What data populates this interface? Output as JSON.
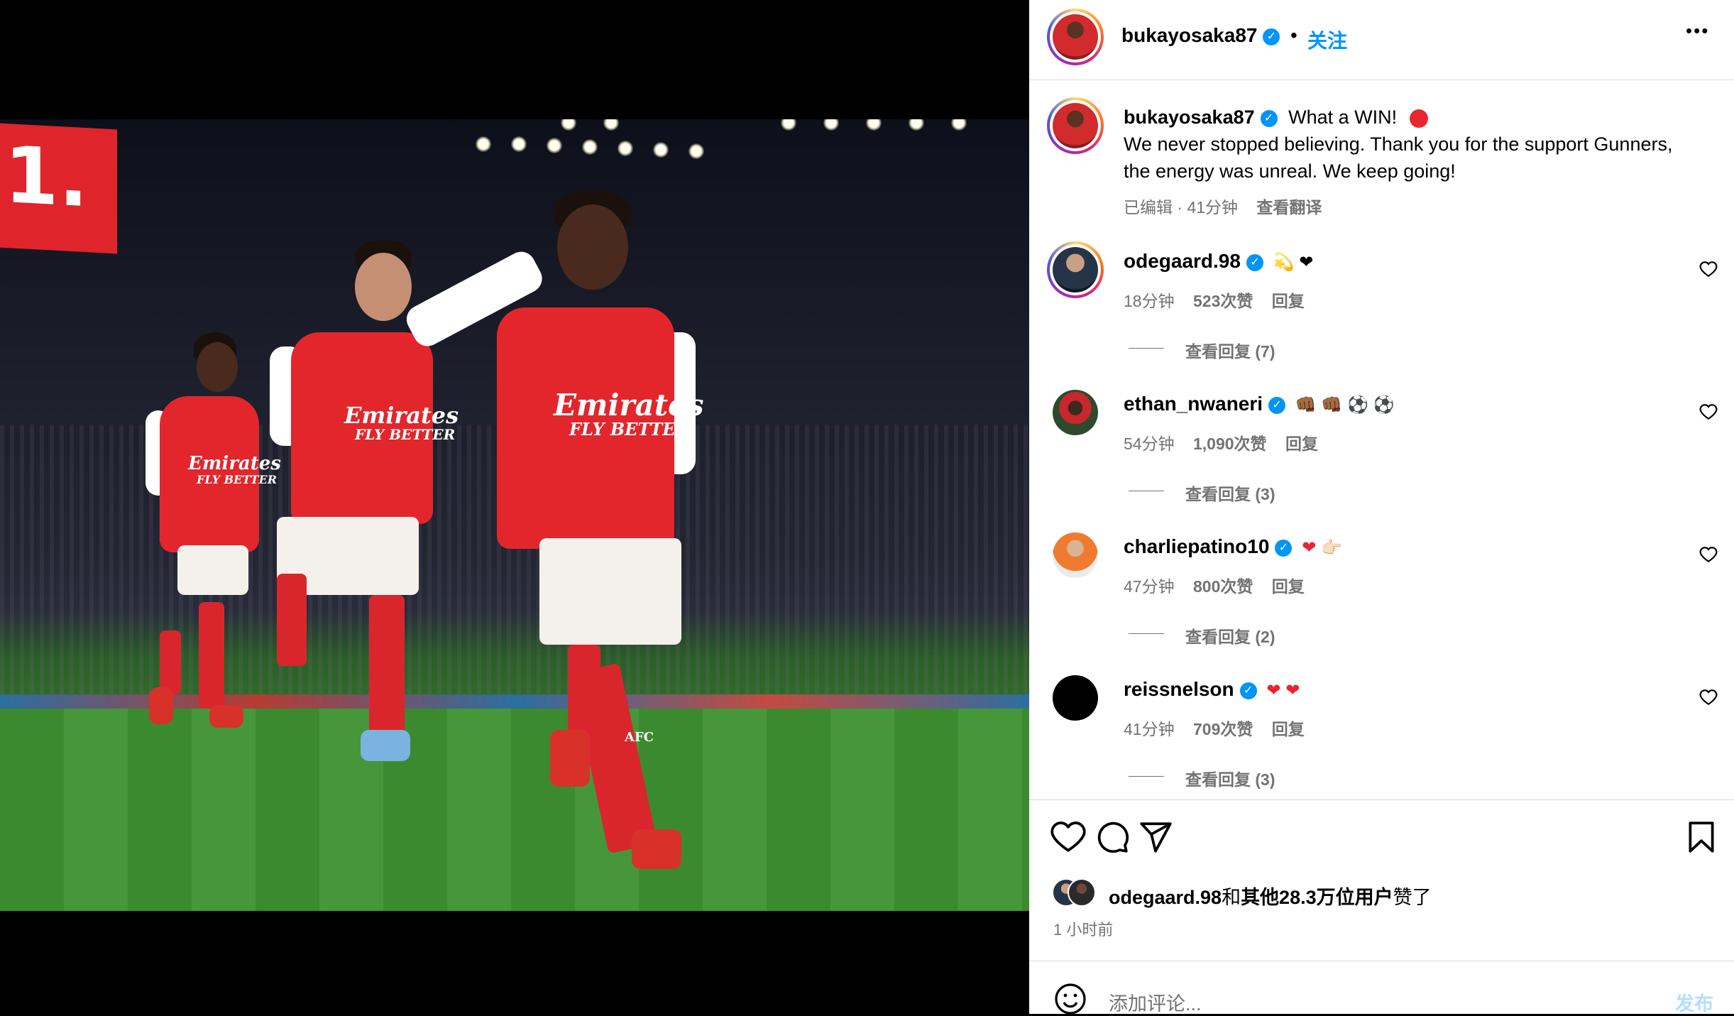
{
  "post": {
    "author": "bukayosaka87",
    "follow_label": "关注",
    "separator": "•",
    "more_label": "•••"
  },
  "caption": {
    "author": "bukayosaka87",
    "line1": "What a WIN!",
    "line2": "We never stopped believing. Thank you for the support Gunners,",
    "line3": "the energy was unreal. We keep going!",
    "edited": "已编辑 · 41分钟",
    "translate": "查看翻译"
  },
  "comments": [
    {
      "user": "odegaard.98",
      "emojis": "💫 ❤",
      "time": "18分钟",
      "likes": "523次赞",
      "reply": "回复",
      "view_replies": "查看回复 (7)"
    },
    {
      "user": "ethan_nwaneri",
      "emojis": "👊🏾 👊🏾 ⚽ ⚽",
      "time": "54分钟",
      "likes": "1,090次赞",
      "reply": "回复",
      "view_replies": "查看回复 (3)"
    },
    {
      "user": "charliepatino10",
      "emojis": "❤ 👉🏻",
      "time": "47分钟",
      "likes": "800次赞",
      "reply": "回复",
      "view_replies": "查看回复 (2)"
    },
    {
      "user": "reissnelson",
      "emojis": "❤ ❤",
      "time": "41分钟",
      "likes": "709次赞",
      "reply": "回复",
      "view_replies": "查看回复 (3)"
    }
  ],
  "likes": {
    "user": "odegaard.98",
    "conj": "和",
    "others": "其他28.3万位用户",
    "suffix": "赞了"
  },
  "time_ago": "1 小时前",
  "composer": {
    "placeholder": "添加评论...",
    "post_label": "发布"
  },
  "photo": {
    "scoreboard": "1.",
    "sponsor1": "Emirates",
    "sponsor1_sub": "FLY BETTER",
    "sponsor2": "Emirates",
    "sponsor2_sub": "FLY BETTER",
    "sponsor3": "Emirates",
    "sponsor3_sub": "FLY BETTER",
    "sock_text": "AFC"
  },
  "colors": {
    "accent": "#0095f6",
    "verified": "#0095f6",
    "heart": "#ed2230",
    "arsenal_red": "#e3262c"
  }
}
